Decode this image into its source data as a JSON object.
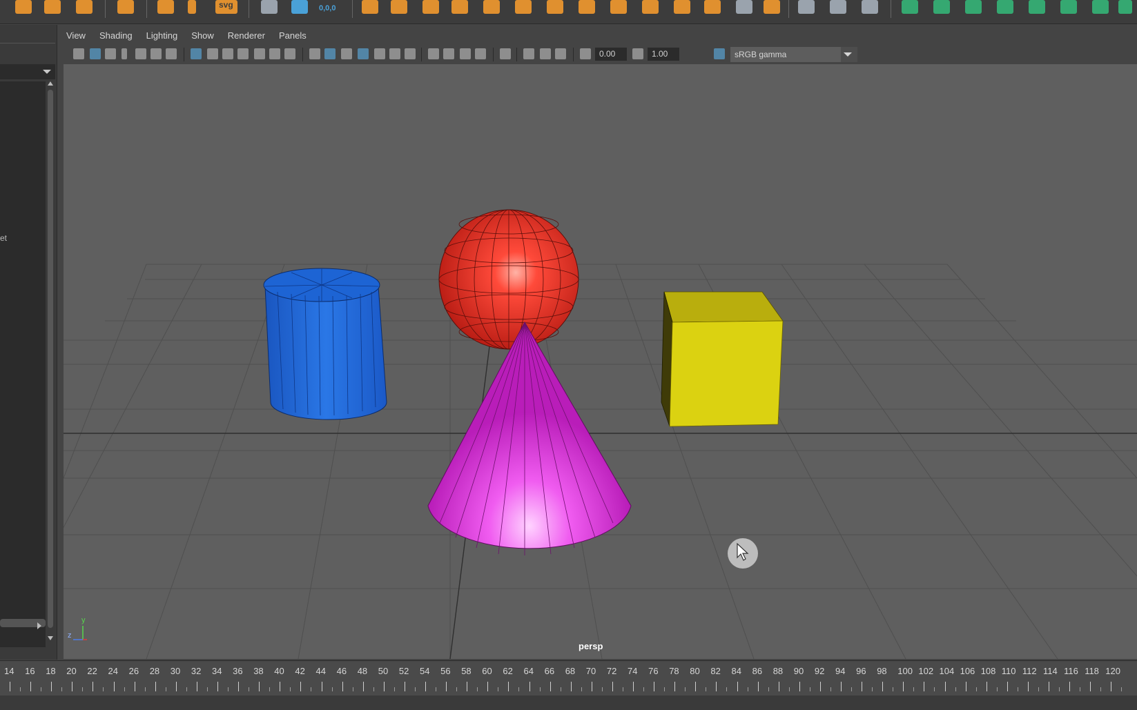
{
  "shelf": {
    "svg_label": "svg",
    "coord_label": "0,0,0"
  },
  "menubar": [
    "View",
    "Shading",
    "Lighting",
    "Show",
    "Renderer",
    "Panels"
  ],
  "toolbar": {
    "exposure_value": "0.00",
    "gamma_value": "1.00",
    "color_space": "sRGB gamma"
  },
  "outliner": {
    "partial_item": "et"
  },
  "viewport": {
    "camera": "persp",
    "axis": {
      "y": "y",
      "z": "z"
    },
    "objects": [
      {
        "name": "cylinder",
        "color": "#1f66d6"
      },
      {
        "name": "sphere",
        "color": "#e8332a"
      },
      {
        "name": "cone",
        "color": "#e23ee3"
      },
      {
        "name": "cube",
        "color": "#d9cf10"
      }
    ]
  },
  "timeline": {
    "ticks": [
      "14",
      "16",
      "18",
      "20",
      "22",
      "24",
      "26",
      "28",
      "30",
      "32",
      "34",
      "36",
      "38",
      "40",
      "42",
      "44",
      "46",
      "48",
      "50",
      "52",
      "54",
      "56",
      "58",
      "60",
      "62",
      "64",
      "66",
      "68",
      "70",
      "72",
      "74",
      "76",
      "78",
      "80",
      "82",
      "84",
      "86",
      "88",
      "90",
      "92",
      "94",
      "96",
      "98",
      "100",
      "102",
      "104",
      "106",
      "108",
      "110",
      "112",
      "114",
      "116",
      "118",
      "120"
    ]
  }
}
